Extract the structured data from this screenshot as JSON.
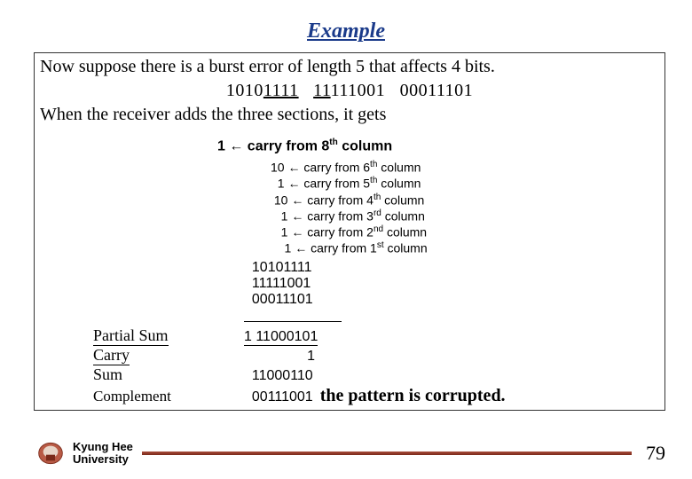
{
  "title": "Example",
  "intro_line1": "Now suppose there is a burst error of length 5 that affects 4 bits.",
  "bits_a_pre": "1010",
  "bits_a_u": "1111",
  "bits_b_u": "11",
  "bits_b_post": "111001",
  "bits_c": "00011101",
  "intro_line2": "When the receiver adds the three sections, it gets",
  "carry_main_num": "1",
  "carry_main_text": " ← carry from 8",
  "carry_main_ord": "th",
  "carry_main_tail": " column",
  "carries": [
    {
      "lead": "10",
      "body": " ← carry from 6",
      "ord": "th",
      "tail": " column"
    },
    {
      "lead": "  1",
      "body": " ← carry from 5",
      "ord": "th",
      "tail": " column"
    },
    {
      "lead": " 10",
      "body": " ← carry from 4",
      "ord": "th",
      "tail": " column"
    },
    {
      "lead": "   1",
      "body": " ← carry from 3",
      "ord": "rd",
      "tail": " column"
    },
    {
      "lead": "   1",
      "body": " ← carry from 2",
      "ord": "nd",
      "tail": " column"
    },
    {
      "lead": "    1",
      "body": " ← carry from 1",
      "ord": "st",
      "tail": " column"
    }
  ],
  "section1": "10101111",
  "section2": "11111001",
  "section3": "00011101",
  "partial_sum_label": "Partial Sum",
  "partial_sum_value": "1 11000101",
  "carry_label": "Carry",
  "carry_value": "                1",
  "sum_label": "Sum",
  "sum_value": "  11000110",
  "complement_label": "Complement",
  "complement_value": "  00111001",
  "corrupted_text": "the pattern is corrupted.",
  "university_line1": "Kyung Hee",
  "university_line2": "University",
  "page_number": "79"
}
